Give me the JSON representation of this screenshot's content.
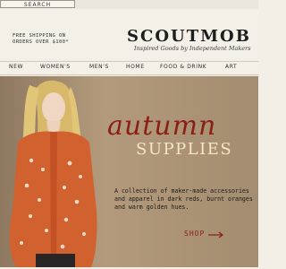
{
  "topbar": {
    "search_label": "SEARCH"
  },
  "header": {
    "shipping_line1": "FREE SHIPPING ON",
    "shipping_line2": "ORDERS OVER $100*",
    "logo": "SCOUTMOB",
    "tagline": "Inspired Goods by Independent Makers"
  },
  "nav": {
    "items": [
      "NEW",
      "WOMEN'S",
      "MEN'S",
      "HOME",
      "FOOD & DRINK",
      "ART"
    ]
  },
  "hero": {
    "headline_script": "autumn",
    "headline_caps": "SUPPLIES",
    "description": "A collection of maker-made accessories and apparel in dark reds, burnt oranges and warm golden hues.",
    "cta": "SHOP"
  },
  "colors": {
    "accent_red": "#8a1f16",
    "headline_cream": "#f5e6c5",
    "hero_background": "#a48c70",
    "page_background": "#f3efe6"
  }
}
